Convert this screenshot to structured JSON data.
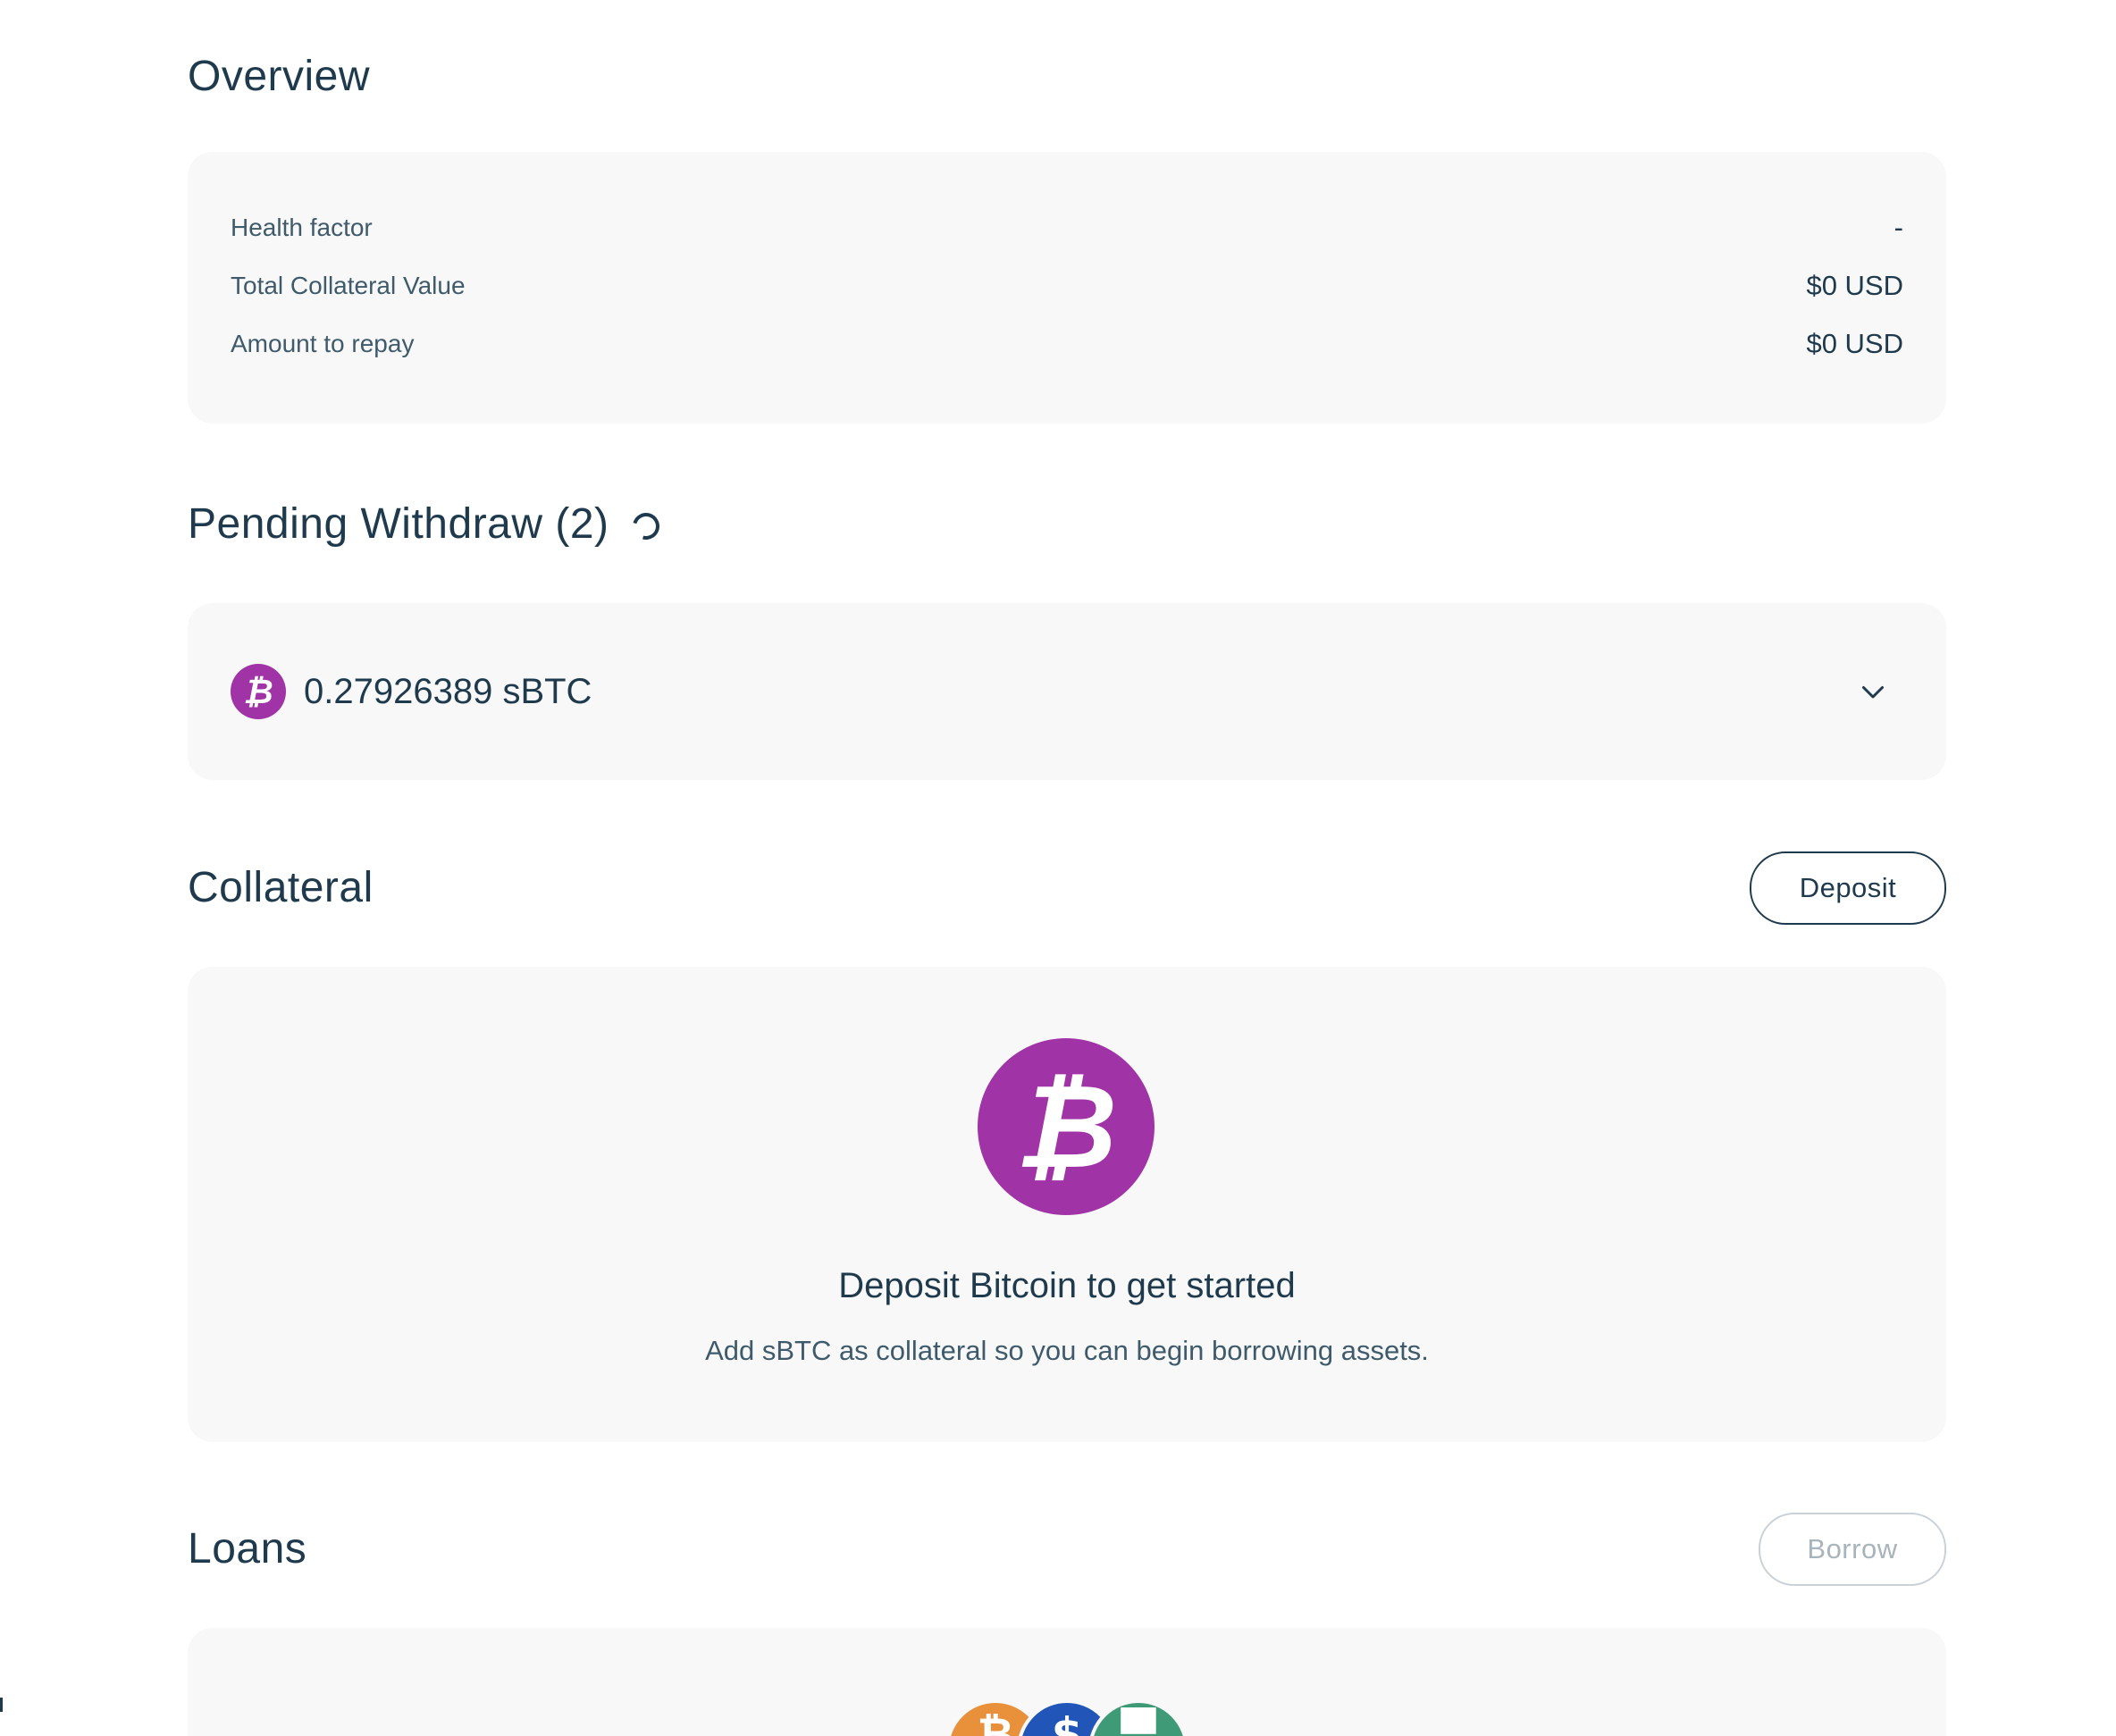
{
  "overview": {
    "title": "Overview",
    "rows": [
      {
        "label": "Health factor",
        "value": "-"
      },
      {
        "label": "Total Collateral Value",
        "value": "$0 USD"
      },
      {
        "label": "Amount to repay",
        "value": "$0 USD"
      }
    ]
  },
  "pending": {
    "title": "Pending Withdraw (2)",
    "item": {
      "amount": "0.27926389 sBTC",
      "icon": "bitcoin-icon"
    }
  },
  "collateral": {
    "title": "Collateral",
    "deposit_label": "Deposit",
    "empty_title": "Deposit Bitcoin to get started",
    "empty_subtitle": "Add sBTC as collateral so you can begin borrowing assets.",
    "icon": "bitcoin-icon",
    "icon_color": "#a034a6"
  },
  "loans": {
    "title": "Loans",
    "borrow_label": "Borrow",
    "coin_icons": [
      "bitcoin-icon",
      "usdc-icon",
      "usdh-icon"
    ]
  }
}
